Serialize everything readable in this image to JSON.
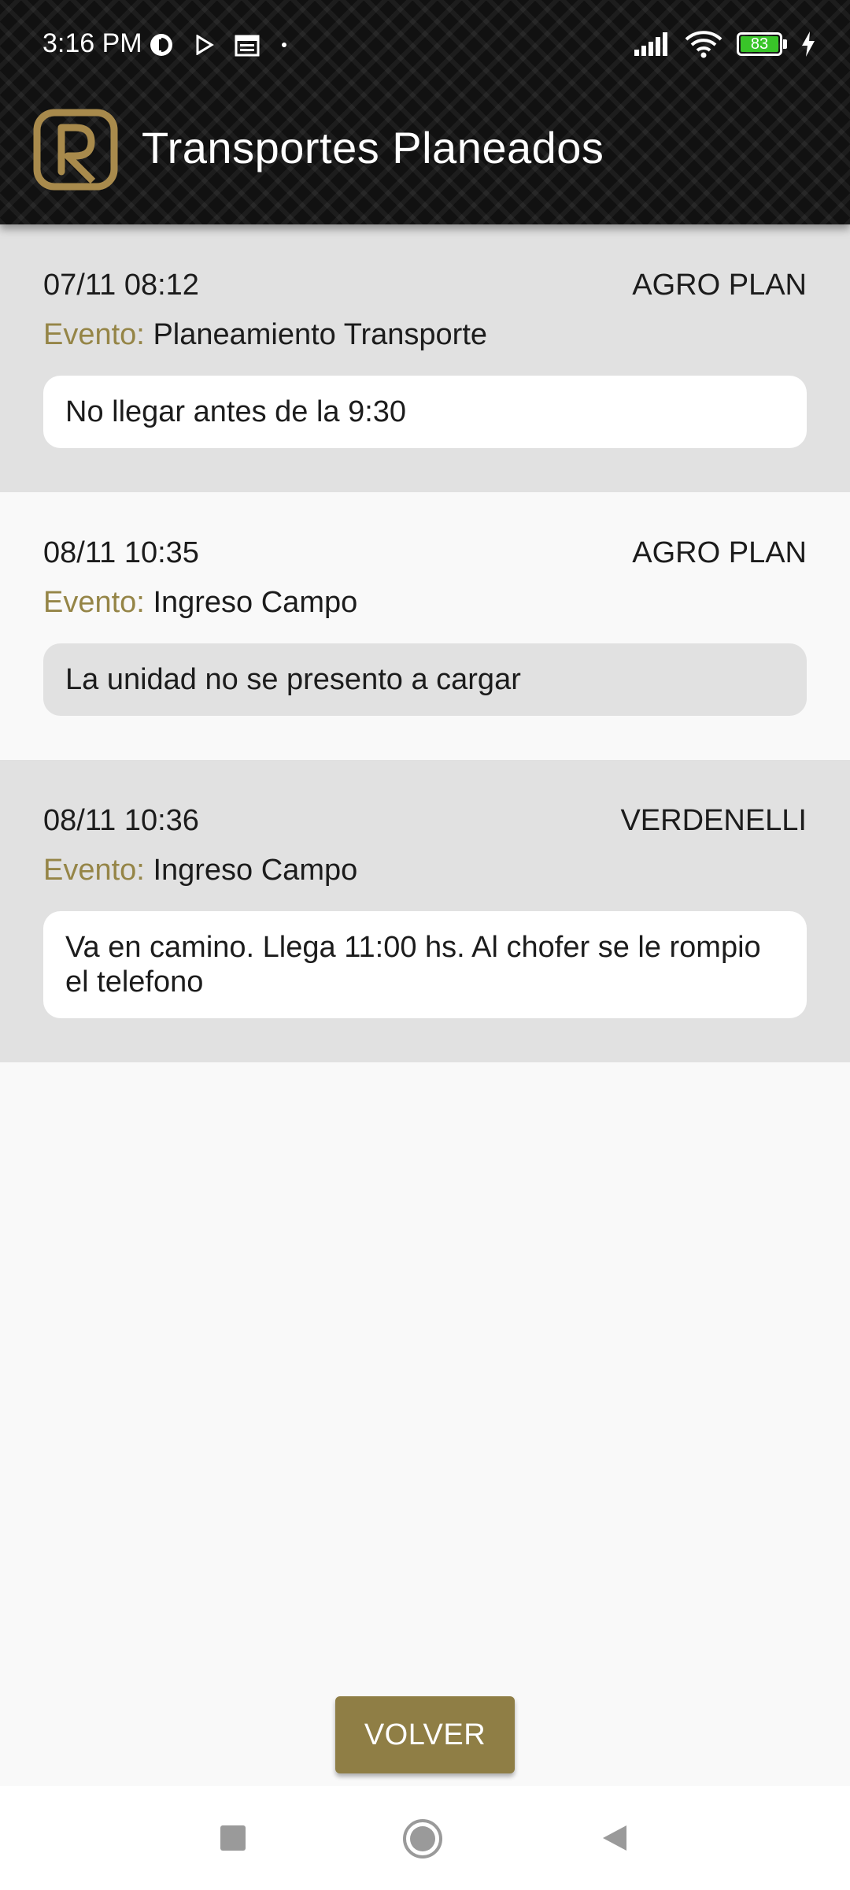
{
  "status_bar": {
    "time": "3:16 PM",
    "battery": "83"
  },
  "header": {
    "title": "Transportes Planeados",
    "logo_icon": "app-logo-icon"
  },
  "items": [
    {
      "date": "07/11 08:12",
      "company": "AGRO PLAN",
      "event_label": "Evento:",
      "event_value": "Planeamiento Transporte",
      "note": "No llegar antes de la 9:30"
    },
    {
      "date": "08/11 10:35",
      "company": "AGRO PLAN",
      "event_label": "Evento:",
      "event_value": "Ingreso Campo",
      "note": "La unidad no se presento a cargar"
    },
    {
      "date": "08/11 10:36",
      "company": "VERDENELLI",
      "event_label": "Evento:",
      "event_value": "Ingreso Campo",
      "note": "Va en camino. Llega 11:00 hs. Al chofer se le rompio el telefono"
    }
  ],
  "actions": {
    "back_label": "VOLVER"
  },
  "colors": {
    "accent": "#958547",
    "button": "#8f7e45",
    "row_shade": "#e1e1e1",
    "background": "#f9f9f9"
  }
}
